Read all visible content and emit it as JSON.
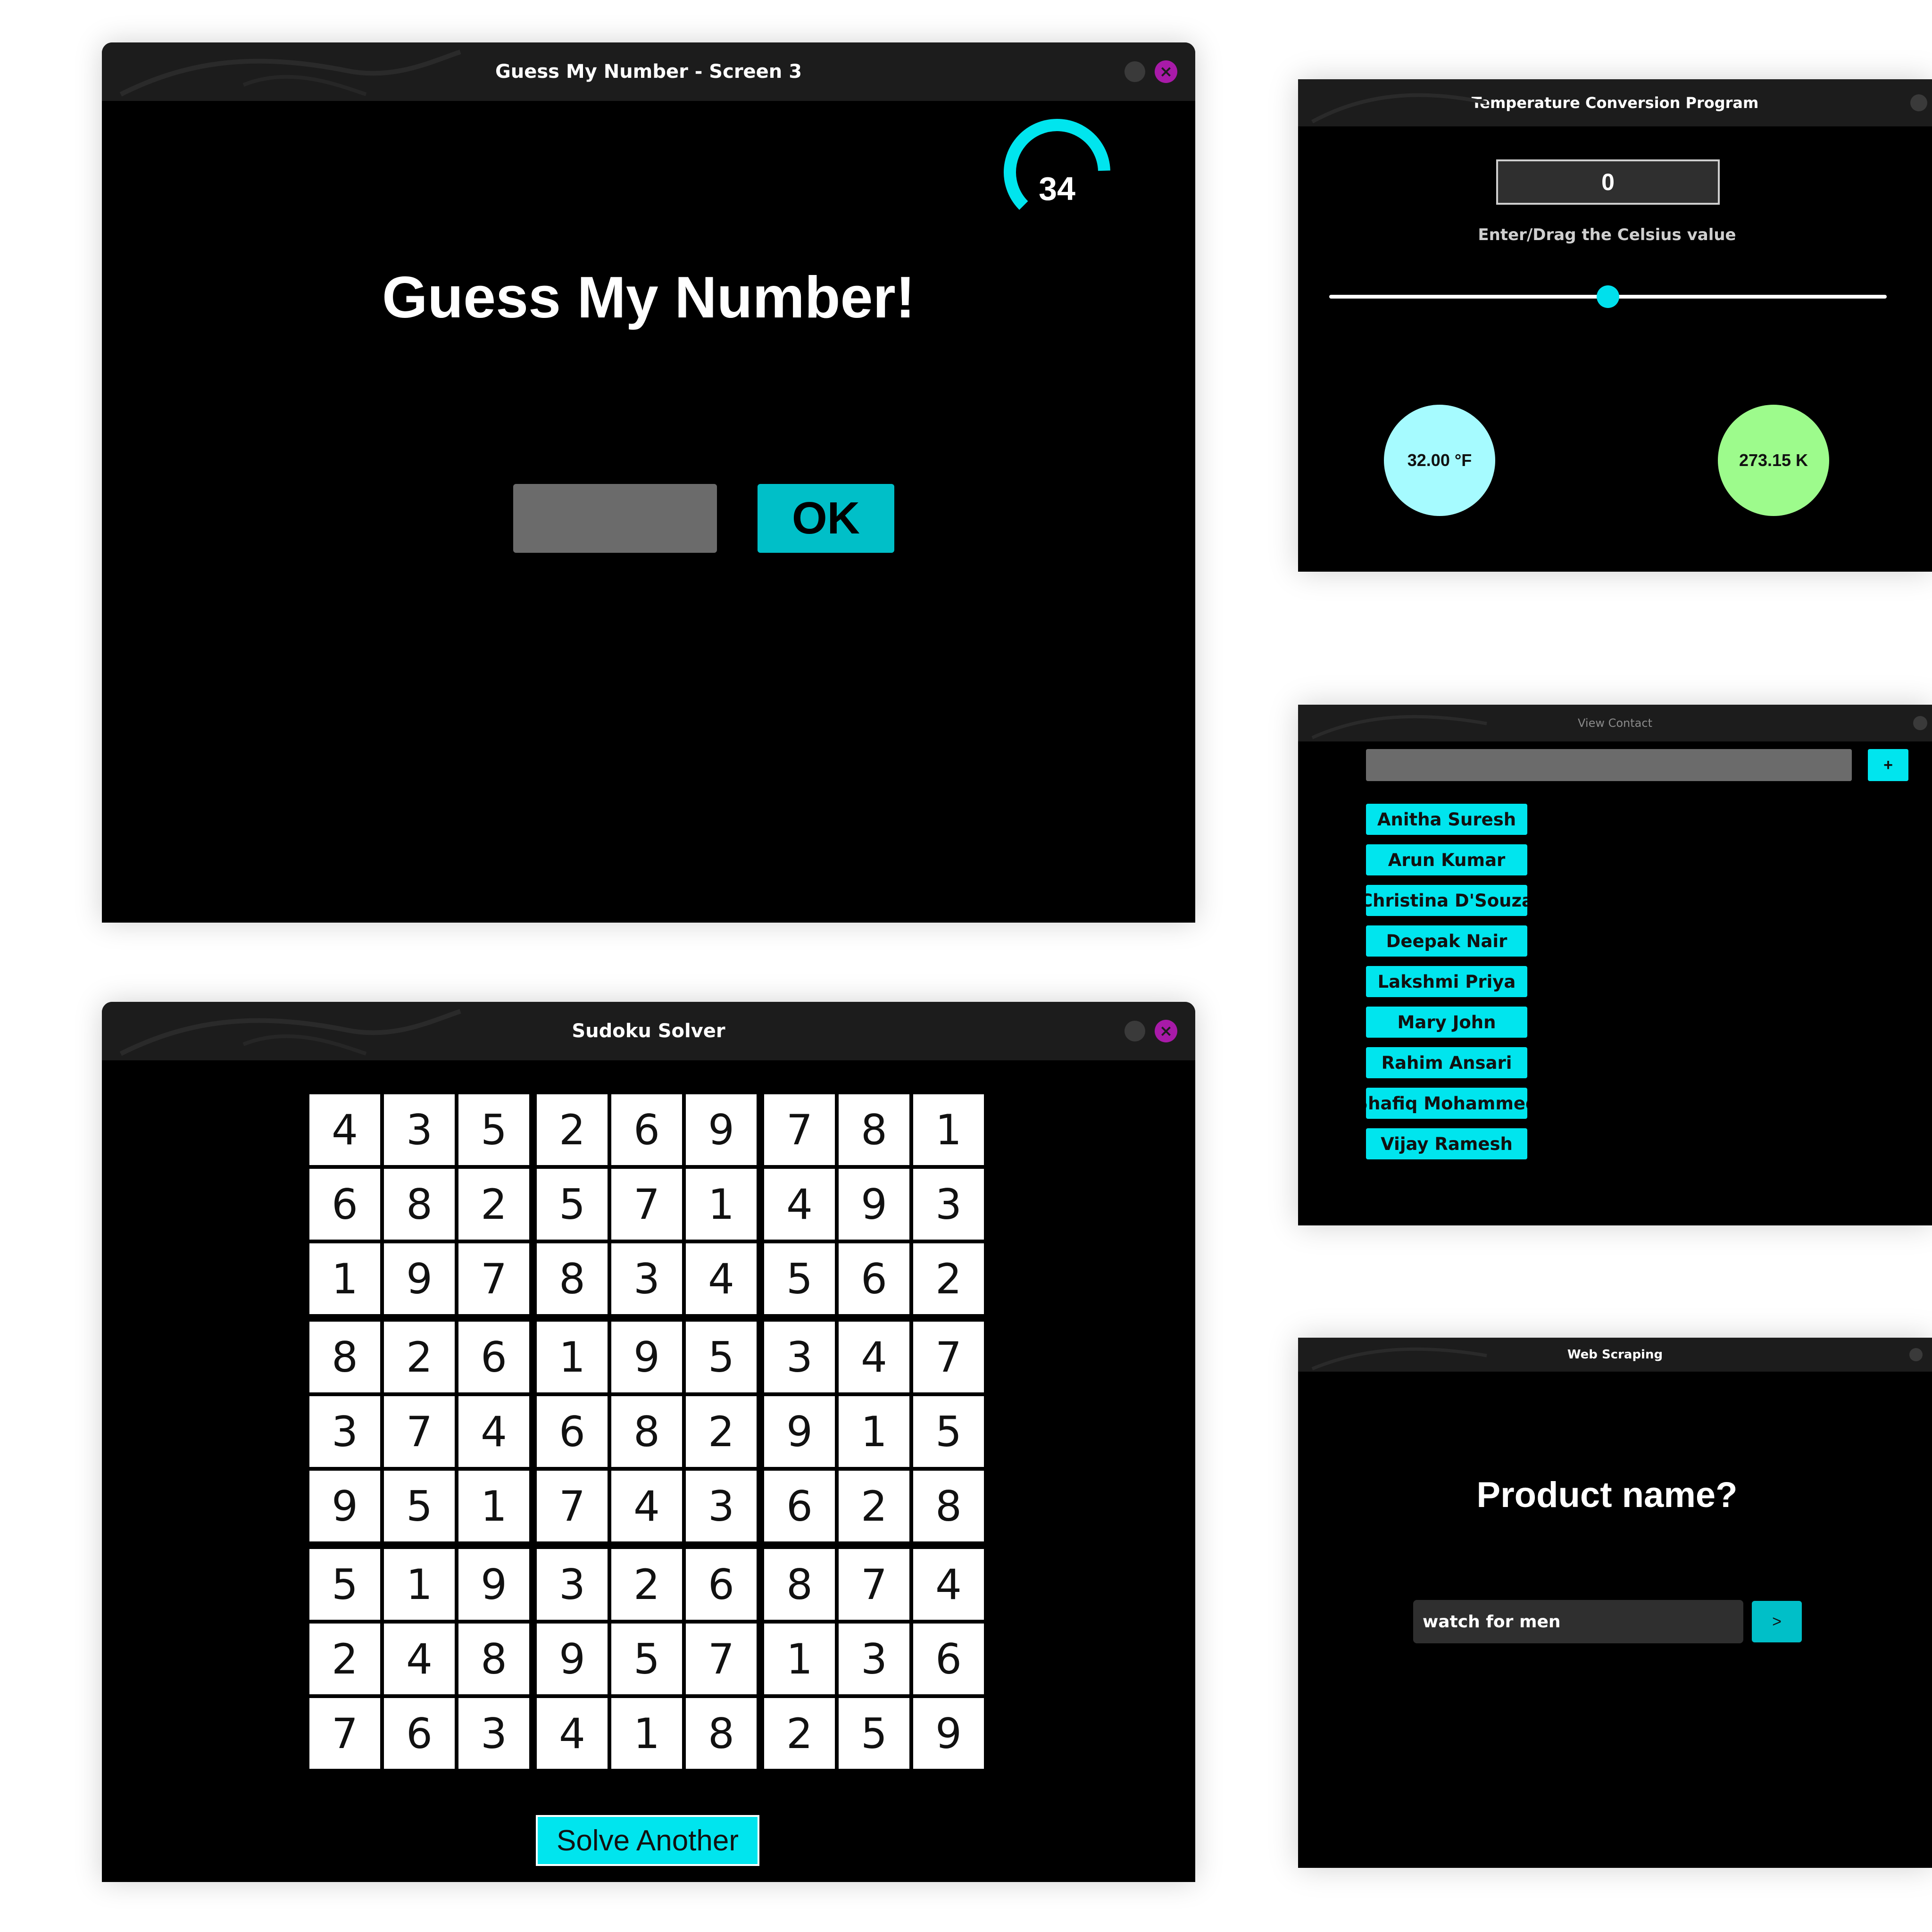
{
  "guess_window": {
    "title": "Guess My Number - Screen 3",
    "timer_value": "34",
    "timer_fraction": 0.62,
    "heading": "Guess My Number!",
    "input_value": "",
    "ok_label": "OK",
    "accent_color": "#00bfc8"
  },
  "sudoku_window": {
    "title": "Sudoku Solver",
    "grid": [
      [
        "4",
        "3",
        "5",
        "2",
        "6",
        "9",
        "7",
        "8",
        "1"
      ],
      [
        "6",
        "8",
        "2",
        "5",
        "7",
        "1",
        "4",
        "9",
        "3"
      ],
      [
        "1",
        "9",
        "7",
        "8",
        "3",
        "4",
        "5",
        "6",
        "2"
      ],
      [
        "8",
        "2",
        "6",
        "1",
        "9",
        "5",
        "3",
        "4",
        "7"
      ],
      [
        "3",
        "7",
        "4",
        "6",
        "8",
        "2",
        "9",
        "1",
        "5"
      ],
      [
        "9",
        "5",
        "1",
        "7",
        "4",
        "3",
        "6",
        "2",
        "8"
      ],
      [
        "5",
        "1",
        "9",
        "3",
        "2",
        "6",
        "8",
        "7",
        "4"
      ],
      [
        "2",
        "4",
        "8",
        "9",
        "5",
        "7",
        "1",
        "3",
        "6"
      ],
      [
        "7",
        "6",
        "3",
        "4",
        "1",
        "8",
        "2",
        "5",
        "9"
      ]
    ],
    "solve_another_label": "Solve Another"
  },
  "temperature_window": {
    "title": "Temperature Conversion Program",
    "celsius_value": "0",
    "caption": "Enter/Drag the Celsius value",
    "slider_position_fraction": 0.5,
    "fahrenheit": "32.00 °F",
    "kelvin": "273.15 K",
    "fahrenheit_color": "#a6fbff",
    "kelvin_color": "#9dfb8c"
  },
  "contacts_window": {
    "title": "View Contact",
    "search_value": "",
    "add_label": "+",
    "contacts": [
      "Anitha Suresh",
      "Arun Kumar",
      "Christina D'Souza",
      "Deepak Nair",
      "Lakshmi Priya",
      "Mary John",
      "Rahim Ansari",
      "Shafiq Mohammed",
      "Vijay Ramesh"
    ]
  },
  "scraping_window": {
    "title": "Web Scraping",
    "heading": "Product name?",
    "input_value": "watch for men",
    "go_label": ">"
  },
  "icons": {
    "minimize": "minimize-icon",
    "close": "close-icon"
  }
}
